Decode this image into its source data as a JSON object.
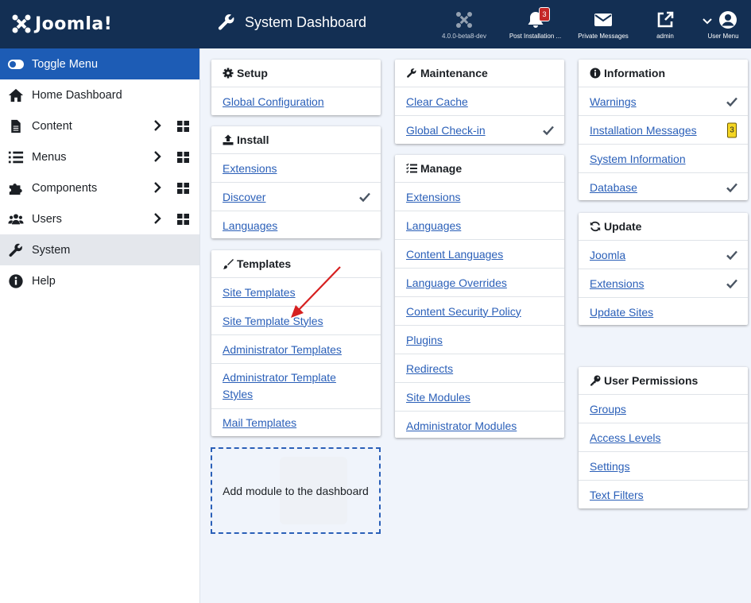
{
  "header": {
    "logo_text": "Joomla!",
    "page_title": "System Dashboard",
    "items": [
      {
        "label": "4.0.0-beta8-dev",
        "icon": "joomla-icon"
      },
      {
        "label": "Post Installation ...",
        "icon": "bell-icon",
        "badge": "3"
      },
      {
        "label": "Private Messages",
        "icon": "envelope-icon"
      },
      {
        "label": "admin",
        "icon": "external-link-icon"
      },
      {
        "label": "User Menu",
        "icon": "user-circle-icon"
      }
    ]
  },
  "sidebar": {
    "items": [
      {
        "label": "Toggle Menu",
        "icon": "toggle-icon"
      },
      {
        "label": "Home Dashboard",
        "icon": "home-icon"
      },
      {
        "label": "Content",
        "icon": "file-icon"
      },
      {
        "label": "Menus",
        "icon": "list-icon"
      },
      {
        "label": "Components",
        "icon": "puzzle-icon"
      },
      {
        "label": "Users",
        "icon": "users-icon"
      },
      {
        "label": "System",
        "icon": "wrench-icon"
      },
      {
        "label": "Help",
        "icon": "info-icon"
      }
    ]
  },
  "cards": {
    "setup": {
      "title": "Setup",
      "rows": [
        "Global Configuration"
      ]
    },
    "install": {
      "title": "Install",
      "rows": [
        "Extensions",
        "Discover",
        "Languages"
      ]
    },
    "templates": {
      "title": "Templates",
      "rows": [
        "Site Templates",
        "Site Template Styles",
        "Administrator Templates",
        "Administrator Template Styles",
        "Mail Templates"
      ]
    },
    "maintenance": {
      "title": "Maintenance",
      "rows": [
        "Clear Cache",
        "Global Check-in"
      ]
    },
    "manage": {
      "title": "Manage",
      "rows": [
        "Extensions",
        "Languages",
        "Content Languages",
        "Language Overrides",
        "Content Security Policy",
        "Plugins",
        "Redirects",
        "Site Modules",
        "Administrator Modules"
      ]
    },
    "information": {
      "title": "Information",
      "rows": [
        "Warnings",
        "Installation Messages",
        "System Information",
        "Database"
      ],
      "badge": "3"
    },
    "update": {
      "title": "Update",
      "rows": [
        "Joomla",
        "Extensions",
        "Update Sites"
      ]
    },
    "user_permissions": {
      "title": "User Permissions",
      "rows": [
        "Groups",
        "Access Levels",
        "Settings",
        "Text Filters"
      ]
    }
  },
  "add_module": {
    "label": "Add module to the dashboard"
  },
  "colors": {
    "header_bg": "#132f53",
    "toggle_bg": "#1d5cb5",
    "link": "#2a5fb8",
    "badge": "#f5d623",
    "alert": "#c52827"
  }
}
